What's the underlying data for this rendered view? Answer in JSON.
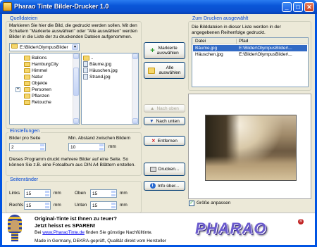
{
  "window": {
    "title": "Pharao Tinte Bilder-Drucker 1.0",
    "min_glyph": "_",
    "max_glyph": "□",
    "close_glyph": "✕"
  },
  "sources": {
    "group_title": "Quelldateien",
    "intro": "Markieren Sie hier die Bild, die gedruckt werden sollen. Mit den Schaltern \"Markierte auswählen\" oder \"Alle auswählen\" werden Bilder in die Liste der zu druckenden Dateien aufgenommen.",
    "path": "E:\\Bilder\\OlympusBilder",
    "folders": [
      "Ballons",
      "HamburgCity",
      "Himmel",
      "Natur",
      "Objekte",
      "Personen",
      "Pflanzen",
      "Retouche"
    ],
    "expand_glyph": "+",
    "files": [
      "..",
      "Bäume.jpg",
      "Häuschen.jpg",
      "Strand.jpg"
    ]
  },
  "actions": {
    "select_marked": "Markierte\nauswählen",
    "select_all": "Alle\nauswählen",
    "move_up": "Nach oben",
    "move_down": "Nach unten",
    "remove": "Entfernen",
    "print": "Drucken...",
    "info": "Info über..."
  },
  "print_list": {
    "group_title": "Zum Drucken ausgewählt",
    "intro": "Die Bilddateien in dieser Liste werden in der angegebenen Reihenfolge gedruckt.",
    "columns": [
      "Datei",
      "Pfad"
    ],
    "rows": [
      {
        "file": "Bäume.jpg",
        "path": "E:\\Bilder\\OlympusBilder\\..."
      },
      {
        "file": "Häuschen.jpg",
        "path": "E:\\Bilder\\OlympusBilder\\..."
      }
    ]
  },
  "settings": {
    "group_title": "Einstellungen",
    "per_page_label": "Bilder pro Seite",
    "per_page_value": "2",
    "min_gap_label": "Min. Abstand zwischen Bildern",
    "min_gap_value": "10",
    "min_gap_unit": "mm",
    "info": "Dieses Programm druckt mehrere Bilder auf eine Seite. So können Sie z.B. eine Fotoalbum aus DIN A4 Blättern erstellen."
  },
  "margins": {
    "group_title": "Seitenränder",
    "left_label": "Links",
    "left_value": "15",
    "left_unit": "mm",
    "top_label": "Oben",
    "top_value": "15",
    "top_unit": "mm",
    "right_label": "Rechts",
    "right_value": "15",
    "right_unit": "mm",
    "bottom_label": "Unten",
    "bottom_value": "15",
    "bottom_unit": "mm"
  },
  "preview": {
    "fit_label": "Größe anpassen",
    "fit_checked": true
  },
  "footer": {
    "headline1": "Original-Tinte ist Ihnen zu teuer?",
    "headline2": "Jetzt heisst es SPAREN!",
    "line1_prefix": "Bei ",
    "link": "www.PharaoTinte.de",
    "line1_suffix": " finden Sie günstige Nachfülltinte.",
    "line2": "Made in Germany, DEKRA-geprüft, Qualität direkt vom Hersteller",
    "logo": "PHARAO",
    "registered": "®"
  },
  "colors": {
    "accent": "#0046d5",
    "titlebar": "#0a56d8",
    "client": "#ece9d8",
    "selection": "#316ac5"
  }
}
